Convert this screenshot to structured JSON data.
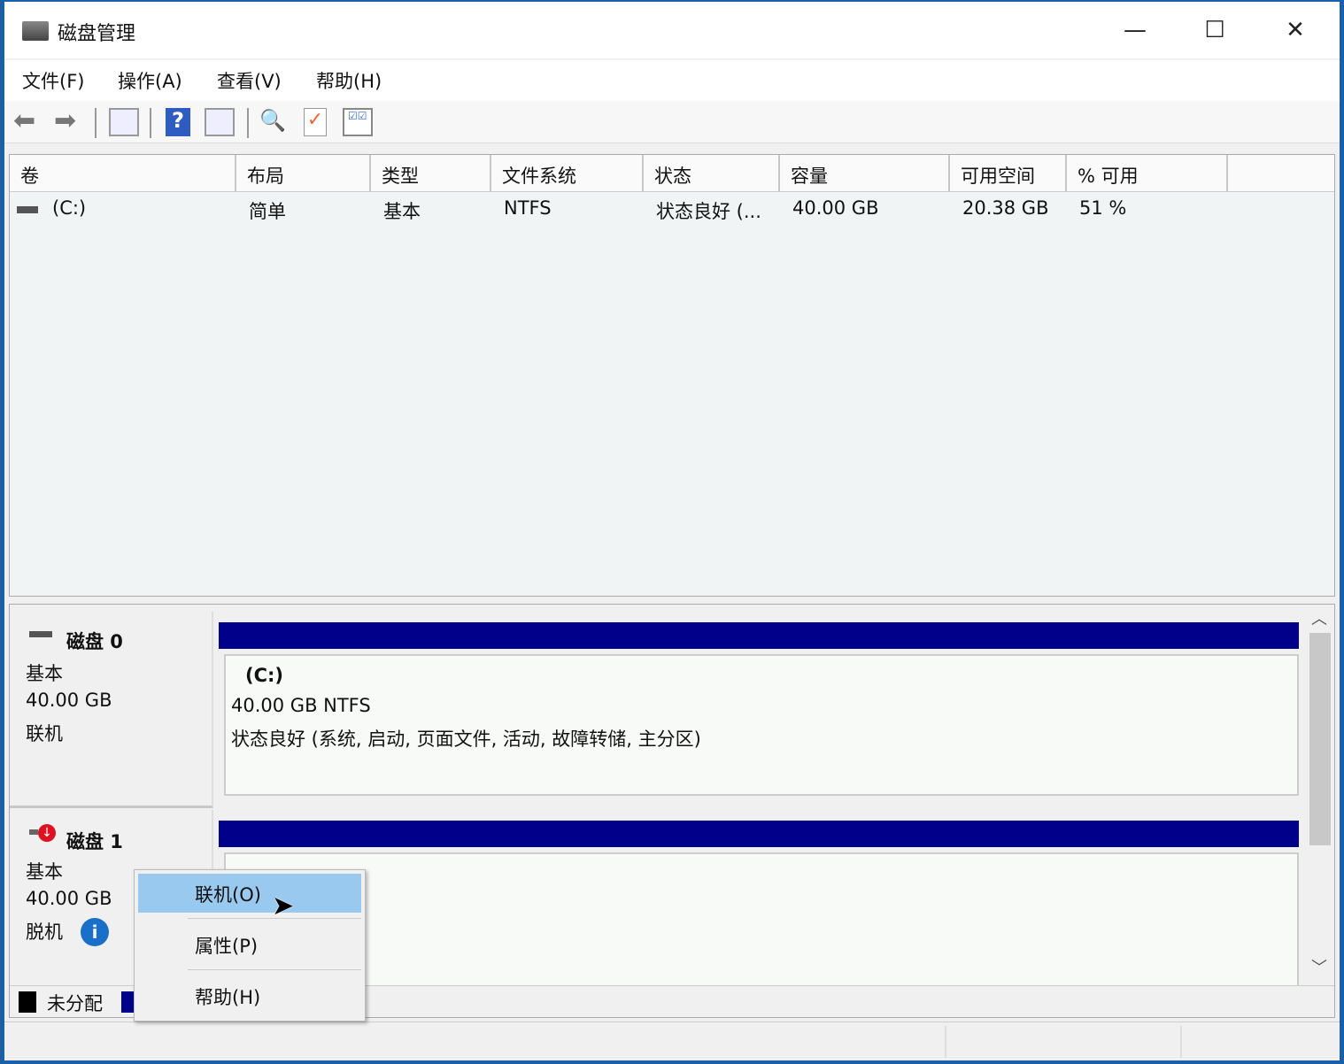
{
  "window": {
    "title": "磁盘管理",
    "minimize": "—",
    "maximize": "☐",
    "close": "✕"
  },
  "menu": [
    "文件(F)",
    "操作(A)",
    "查看(V)",
    "帮助(H)"
  ],
  "table": {
    "columns": [
      "卷",
      "布局",
      "类型",
      "文件系统",
      "状态",
      "容量",
      "可用空间",
      "% 可用"
    ],
    "rows": [
      {
        "volume": "(C:)",
        "layout": "简单",
        "type": "基本",
        "fs": "NTFS",
        "status": "状态良好 (...",
        "capacity": "40.00 GB",
        "free": "20.38 GB",
        "pct": "51 %"
      }
    ]
  },
  "disks": [
    {
      "name": "磁盘 0",
      "type": "基本",
      "size": "40.00 GB",
      "state": "联机",
      "partition": {
        "label": "(C:)",
        "info": "40.00 GB NTFS",
        "status": "状态良好 (系统, 启动, 页面文件, 活动, 故障转储, 主分区)"
      }
    },
    {
      "name": "磁盘 1",
      "type": "基本",
      "size": "40.00 GB",
      "state": "脱机"
    }
  ],
  "legend": {
    "unallocated": "未分配"
  },
  "context_menu": [
    "联机(O)",
    "属性(P)",
    "帮助(H)"
  ],
  "colors": {
    "partition_bar": "#00008b",
    "menu_highlight": "#99c9ef"
  }
}
